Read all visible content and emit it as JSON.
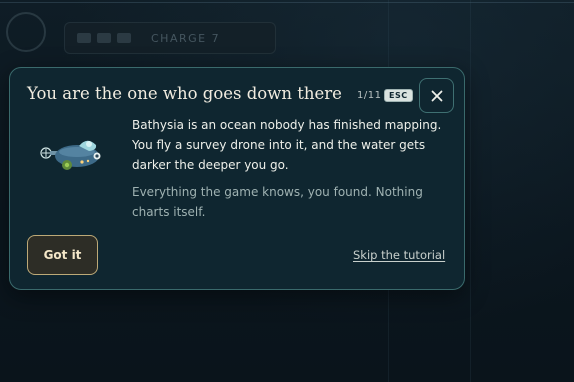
{
  "background": {
    "hud_text": "CHARGE 7"
  },
  "tutorial": {
    "title": "You are the one who goes down there",
    "step_indicator": "1/11",
    "esc_key": "ESC",
    "close_icon": "close-icon",
    "illustration_icon": "survey-drone-icon",
    "body_paragraph_1": "Bathysia is an ocean nobody has finished mapping. You fly a survey drone into it, and the water gets darker the deeper you go.",
    "body_paragraph_2": "Everything the game knows, you found. Nothing charts itself.",
    "primary_button_label": "Got it",
    "skip_link_label": "Skip the tutorial"
  },
  "colors": {
    "card_background": "#0f2630",
    "card_border": "#3a6a6c",
    "button_border": "#bda977",
    "title_text": "#f1ece0",
    "secondary_text": "#9fb2b2"
  }
}
